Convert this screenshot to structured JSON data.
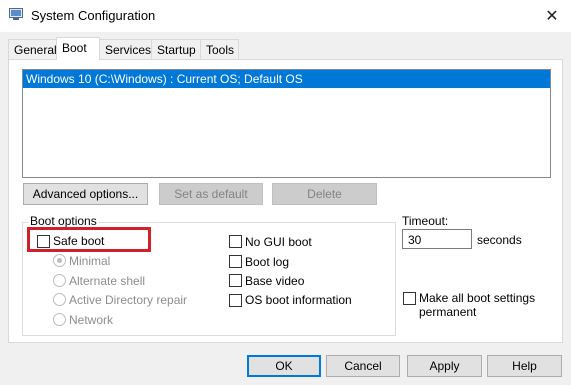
{
  "window": {
    "title": "System Configuration",
    "close_glyph": "✕"
  },
  "tabs": [
    {
      "label": "General"
    },
    {
      "label": "Boot"
    },
    {
      "label": "Services"
    },
    {
      "label": "Startup"
    },
    {
      "label": "Tools"
    }
  ],
  "active_tab": "Boot",
  "boot_list": {
    "items": [
      "Windows 10 (C:\\Windows) : Current OS; Default OS"
    ],
    "selected_index": 0
  },
  "list_buttons": {
    "advanced": "Advanced options...",
    "set_default": "Set as default",
    "delete": "Delete"
  },
  "boot_options": {
    "label": "Boot options",
    "safe_boot": {
      "label": "Safe boot",
      "checked": false
    },
    "safe_boot_modes": [
      {
        "label": "Minimal",
        "selected": true
      },
      {
        "label": "Alternate shell",
        "selected": false
      },
      {
        "label": "Active Directory repair",
        "selected": false
      },
      {
        "label": "Network",
        "selected": false
      }
    ],
    "right_options": [
      {
        "label": "No GUI boot",
        "checked": false
      },
      {
        "label": "Boot log",
        "checked": false
      },
      {
        "label": "Base video",
        "checked": false
      },
      {
        "label": "OS boot information",
        "checked": false
      }
    ]
  },
  "timeout": {
    "label": "Timeout:",
    "value": "30",
    "unit": "seconds"
  },
  "make_permanent": {
    "line1": "Make all boot settings",
    "line2": "permanent",
    "checked": false
  },
  "dialog_buttons": {
    "ok": "OK",
    "cancel": "Cancel",
    "apply": "Apply",
    "help": "Help"
  },
  "colors": {
    "selection": "#0078d7",
    "highlight_box": "#d0202a"
  },
  "icons": {
    "app": "system-configuration-icon",
    "close": "close-icon"
  }
}
